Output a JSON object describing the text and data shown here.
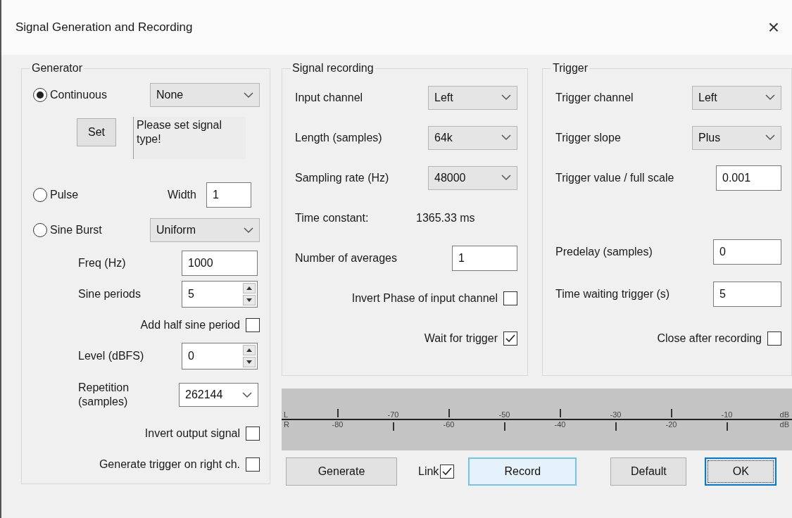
{
  "window": {
    "title": "Signal Generation and Recording",
    "close": "×"
  },
  "generator": {
    "title": "Generator",
    "modes": [
      {
        "kind": "select",
        "label": "Continuous",
        "selected": true,
        "value": "None",
        "button": "Set",
        "message": "Please set signal type!"
      },
      {
        "kind": "number",
        "label": "Pulse",
        "selected": false,
        "field_label": "Width",
        "value": "1"
      },
      {
        "kind": "select",
        "label": "Sine Burst",
        "selected": false,
        "value": "Uniform"
      }
    ],
    "options": [
      {
        "kind": "text",
        "label": "Freq (Hz)",
        "value": "1000"
      },
      {
        "kind": "spin",
        "label": "Sine periods",
        "value": "5"
      },
      {
        "kind": "check",
        "label": "Add half sine period",
        "checked": false
      },
      {
        "kind": "spin",
        "label": "Level (dBFS)",
        "value": "0"
      },
      {
        "kind": "select",
        "label": "Repetition (samples)",
        "value": "262144"
      },
      {
        "kind": "check",
        "label": "Invert output signal",
        "checked": false
      },
      {
        "kind": "check",
        "label": "Generate trigger on right ch.",
        "checked": false
      }
    ]
  },
  "recording": {
    "title": "Signal recording",
    "rows": [
      {
        "kind": "select",
        "label": "Input channel",
        "value": "Left"
      },
      {
        "kind": "select",
        "label": "Length (samples)",
        "value": "64k"
      },
      {
        "kind": "select",
        "label": "Sampling rate (Hz)",
        "value": "48000"
      },
      {
        "kind": "info",
        "label": "Time constant:",
        "value": "1365.33 ms"
      },
      {
        "kind": "text",
        "label": "Number of averages",
        "value": "1"
      },
      {
        "kind": "check",
        "label": "Invert Phase of input channel",
        "checked": false
      },
      {
        "kind": "check",
        "label": "Wait for trigger",
        "checked": true
      }
    ]
  },
  "trigger": {
    "title": "Trigger",
    "rows": [
      {
        "kind": "select",
        "label": "Trigger channel",
        "value": "Left"
      },
      {
        "kind": "select",
        "label": "Trigger slope",
        "value": "Plus"
      },
      {
        "kind": "text",
        "label": "Trigger value / full scale",
        "value": "0.001"
      },
      {
        "kind": "text",
        "label": "Predelay (samples)",
        "value": "0"
      },
      {
        "kind": "text",
        "label": "Time waiting trigger (s)",
        "value": "5"
      },
      {
        "kind": "check",
        "label": "Close after recording",
        "checked": false
      }
    ]
  },
  "meter": {
    "left_channel": "L",
    "right_channel": "R",
    "left_scale": [
      "-70",
      "-50",
      "-30",
      "-10"
    ],
    "right_scale": [
      "-80",
      "-60",
      "-40",
      "-20"
    ],
    "left_unit": "dB",
    "right_unit": "dB"
  },
  "buttons": [
    {
      "kind": "button",
      "label": "Generate",
      "highlighted": false,
      "default": false
    },
    {
      "kind": "check",
      "label": "Link",
      "checked": true
    },
    {
      "kind": "button",
      "label": "Record",
      "highlighted": true,
      "default": false
    },
    {
      "kind": "button",
      "label": "Default",
      "highlighted": false,
      "default": false
    },
    {
      "kind": "button",
      "label": "OK",
      "highlighted": false,
      "default": true
    }
  ]
}
